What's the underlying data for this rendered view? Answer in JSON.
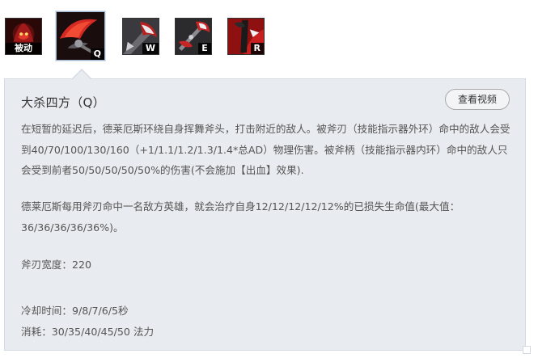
{
  "skills": [
    {
      "id": "passive",
      "label": "被动",
      "colors": {
        "bg": "#2a0808",
        "accent": "#c0221e"
      }
    },
    {
      "id": "q",
      "label": "Q",
      "colors": {
        "bg": "#1a0d0d",
        "accent": "#d32a24"
      }
    },
    {
      "id": "w",
      "label": "W",
      "colors": {
        "bg": "#3a3a3e",
        "accent": "#b82020"
      }
    },
    {
      "id": "e",
      "label": "E",
      "colors": {
        "bg": "#2b2a2c",
        "accent": "#c72626"
      }
    },
    {
      "id": "r",
      "label": "R",
      "colors": {
        "bg": "#c91f1f",
        "accent": "#1a1a1a"
      }
    }
  ],
  "selected_skill": "q",
  "tooltip": {
    "title": "大杀四方（Q）",
    "video_button": "查看视频",
    "paragraphs": [
      "在短暂的延迟后，德莱厄斯环绕自身挥舞斧头，打击附近的敌人。被斧刃（技能指示器外环）命中的敌人会受到40/70/100/130/160（+1/1.1/1.2/1.3/1.4*总AD）物理伤害。被斧柄（技能指示器内环）命中的敌人只会受到前者50/50/50/50/50%的伤害(不会施加【出血】效果).",
      "德莱厄斯每用斧刃命中一名敌方英雄，就会治疗自身12/12/12/12/12%的已损失生命值(最大值：36/36/36/36/36%)。",
      "斧刃宽度：220",
      "冷却时间：9/8/7/6/5秒\n消耗：30/35/40/45/50 法力"
    ]
  },
  "theme": {
    "panel_bg": "#e8ebef",
    "panel_border": "#d3dae2",
    "text": "#555555",
    "title": "#333333"
  }
}
